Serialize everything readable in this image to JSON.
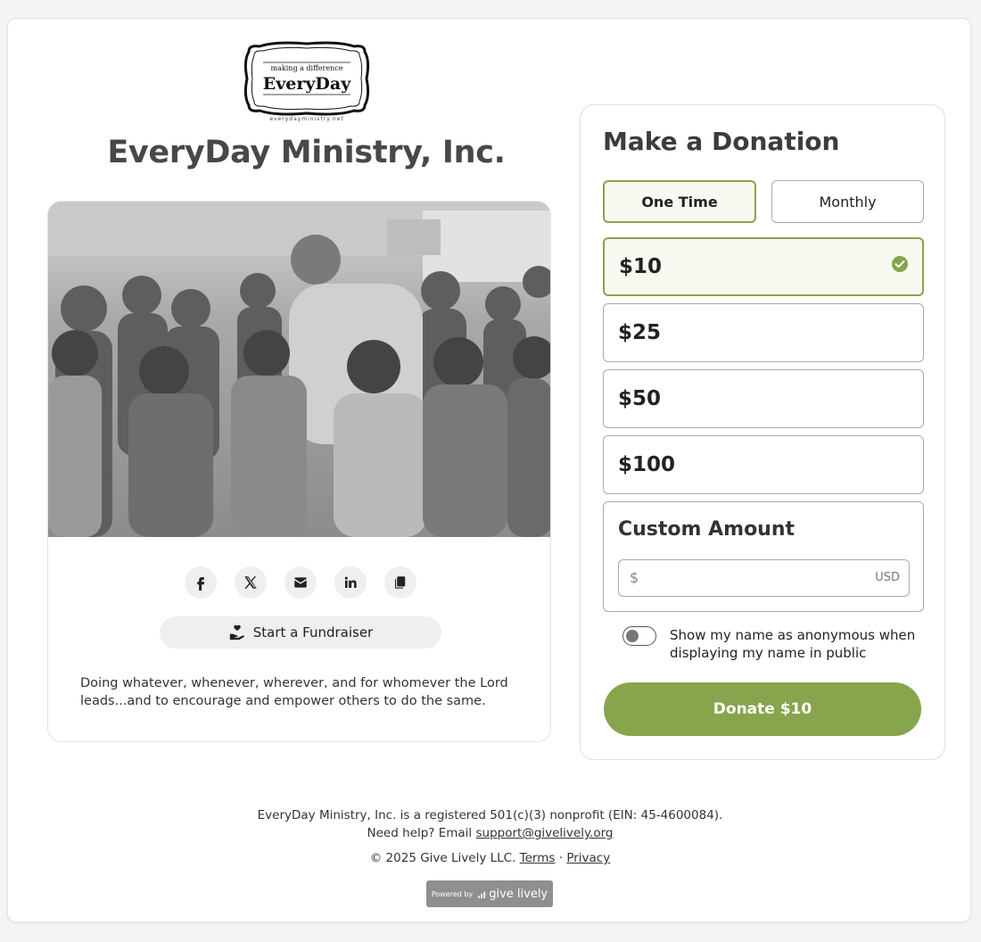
{
  "org": {
    "name": "EveryDay Ministry, Inc.",
    "logo": {
      "tagline": "making a difference",
      "wordmark": "EveryDay",
      "url": "everydayministry.net"
    },
    "mission": "Doing whatever, whenever, wherever, and for whomever the Lord leads...and to encourage and empower others to do the same."
  },
  "share": {
    "icons": [
      "facebook-icon",
      "x-icon",
      "email-icon",
      "linkedin-icon",
      "copy-link-icon"
    ]
  },
  "fundraiser": {
    "label": "Start a Fundraiser",
    "icon": "hand-heart-icon"
  },
  "donation": {
    "title": "Make a Donation",
    "frequency": {
      "one_time": "One Time",
      "monthly": "Monthly",
      "selected": "One Time"
    },
    "amounts": [
      "$10",
      "$25",
      "$50",
      "$100"
    ],
    "selected_amount": "$10",
    "custom": {
      "label": "Custom Amount",
      "prefix": "$",
      "suffix": "USD",
      "value": ""
    },
    "anonymous": {
      "label": "Show my name as anonymous when displaying my name in public",
      "enabled": false
    },
    "submit_label": "Donate $10"
  },
  "footer": {
    "nonprofit_line": "EveryDay Ministry, Inc. is a registered 501(c)(3) nonprofit (EIN: 45-4600084).",
    "help_prefix": "Need help? Email",
    "help_email": "support@givelively.org",
    "copyright": "© 2025 Give Lively LLC.",
    "terms": "Terms",
    "separator": "·",
    "privacy": "Privacy",
    "powered_label": "Powered by",
    "powered_brand": "give lively"
  },
  "colors": {
    "accent": "#86a54c",
    "accent_bg": "#f7f9f1",
    "text": "#333333",
    "title": "#484848"
  }
}
